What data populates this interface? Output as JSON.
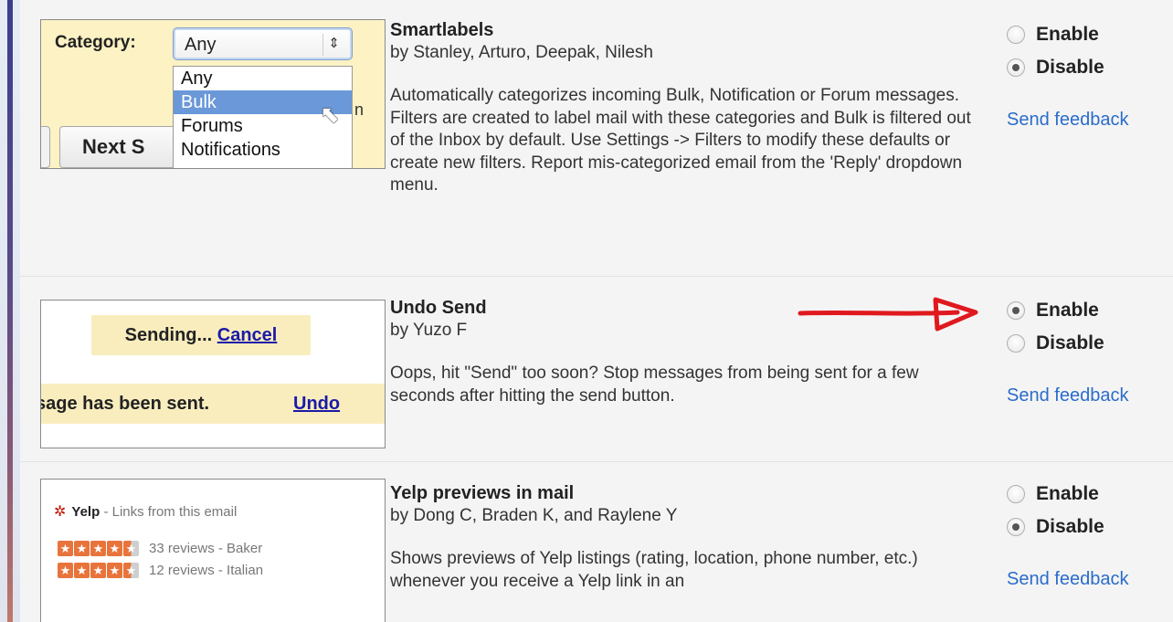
{
  "colors": {
    "link": "#2a6ccb",
    "accent_stripe": "#3b3f8e",
    "highlight": "#6a98d8",
    "notice_bg": "#f9edbe"
  },
  "labs": [
    {
      "title": "Smartlabels",
      "authors": "by Stanley, Arturo, Deepak, Nilesh",
      "description": "Automatically categorizes incoming Bulk, Notification or Forum messages. Filters are created to label mail with these categories and Bulk is filtered out of the Inbox by default. Use Settings -> Filters to modify these defaults or create new filters. Report mis-categorized email from the 'Reply' dropdown menu.",
      "enable_label": "Enable",
      "disable_label": "Disable",
      "selected": "Disable",
      "feedback": "Send feedback",
      "preview": {
        "category_label": "Category:",
        "select_value": "Any",
        "select_icon": "updown-arrows-icon",
        "options": [
          "Any",
          "Bulk",
          "Forums",
          "Notifications"
        ],
        "highlighted": "Bulk",
        "button_label": "Next S",
        "edge_char": "n"
      }
    },
    {
      "title": "Undo Send",
      "authors": "by Yuzo F",
      "description": "Oops, hit \"Send\" too soon? Stop messages from being sent for a few seconds after hitting the send button.",
      "enable_label": "Enable",
      "disable_label": "Disable",
      "selected": "Enable",
      "feedback": "Send feedback",
      "preview": {
        "sending_text": "Sending...",
        "cancel_link": "Cancel",
        "sent_text": "sage has been sent.",
        "undo_link": "Undo"
      }
    },
    {
      "title": "Yelp previews in mail",
      "authors": "by Dong C, Braden K, and Raylene Y",
      "description": "Shows previews of Yelp listings (rating, location, phone number, etc.) whenever you receive a Yelp link in an",
      "enable_label": "Enable",
      "disable_label": "Disable",
      "selected": "Disable",
      "feedback": "Send feedback",
      "preview": {
        "brand": "Yelp",
        "header_text": "- Links from this email",
        "listings": [
          {
            "rating": 4.5,
            "text": "33 reviews - Baker"
          },
          {
            "rating": 4.5,
            "text": "12 reviews - Italian"
          }
        ]
      }
    }
  ]
}
